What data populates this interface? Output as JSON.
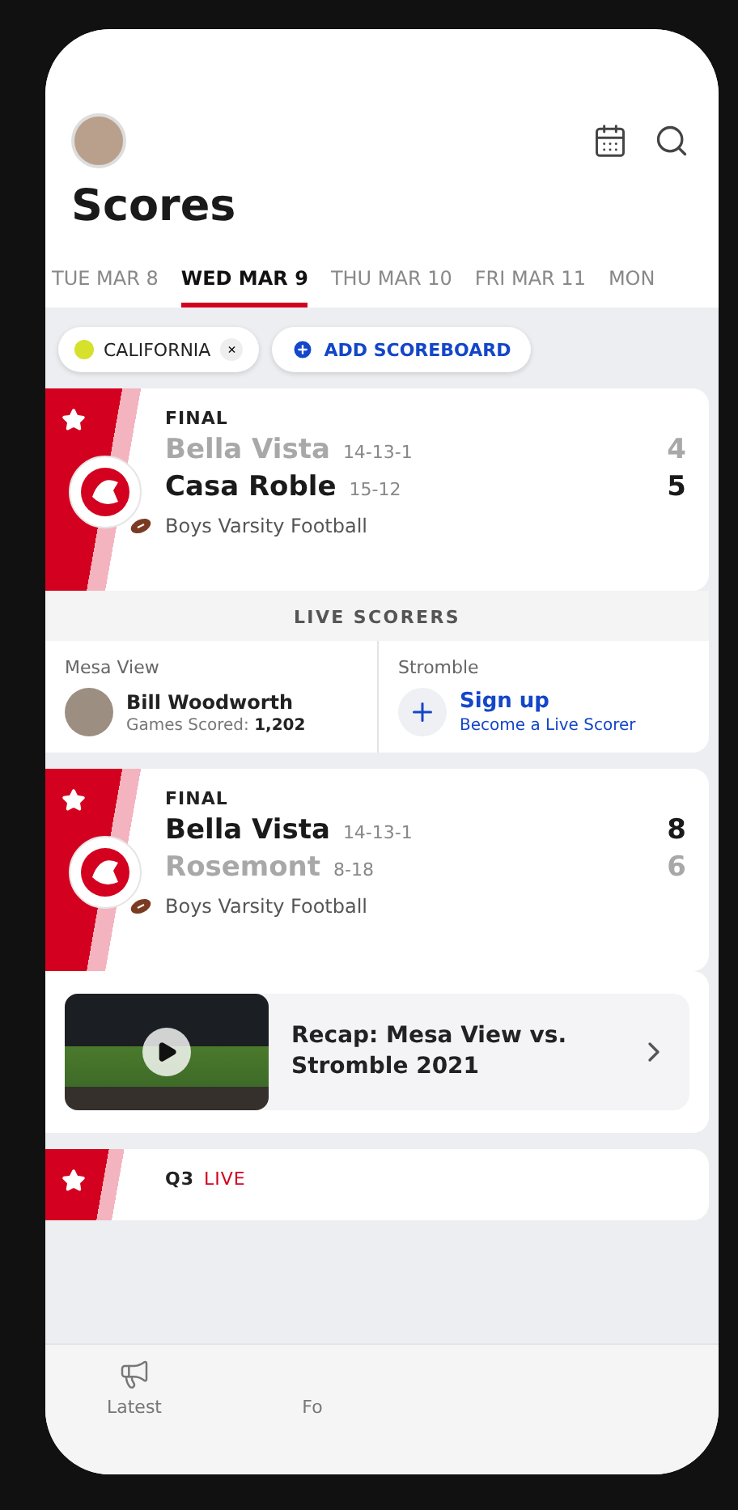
{
  "header": {
    "title": "Scores"
  },
  "date_tabs": [
    {
      "label": "TUE MAR 8",
      "selected": false
    },
    {
      "label": "WED MAR 9",
      "selected": true
    },
    {
      "label": "THU MAR 10",
      "selected": false
    },
    {
      "label": "FRI MAR 11",
      "selected": false
    },
    {
      "label": "MON",
      "selected": false
    }
  ],
  "filters": {
    "chips": [
      {
        "label": "CALIFORNIA",
        "remove": "×"
      }
    ],
    "add_button": "ADD SCOREBOARD"
  },
  "games": [
    {
      "status": "FINAL",
      "favorite": true,
      "sport": "Boys Varsity Football",
      "teams": [
        {
          "name": "Bella Vista",
          "record": "14-13-1",
          "score": "4",
          "winner": false
        },
        {
          "name": "Casa Roble",
          "record": "15-12",
          "score": "5",
          "winner": true
        }
      ],
      "live_scorers": {
        "title": "LIVE SCORERS",
        "entries": [
          {
            "kind": "scorer",
            "team": "Mesa View",
            "name": "Bill Woodworth",
            "stat_label": "Games Scored:",
            "stat_value": "1,202"
          },
          {
            "kind": "signup",
            "team": "Stromble",
            "action": "Sign up",
            "subtitle": "Become a Live Scorer"
          }
        ]
      }
    },
    {
      "status": "FINAL",
      "favorite": true,
      "sport": "Boys Varsity Football",
      "teams": [
        {
          "name": "Bella Vista",
          "record": "14-13-1",
          "score": "8",
          "winner": true
        },
        {
          "name": "Rosemont",
          "record": "8-18",
          "score": "6",
          "winner": false
        }
      ],
      "recap": {
        "title": "Recap: Mesa View vs. Stromble 2021"
      }
    },
    {
      "status": "Q3",
      "live_label": "LIVE",
      "favorite": true
    }
  ],
  "bottom_nav": [
    {
      "label": "Latest"
    },
    {
      "label": "Fo"
    }
  ]
}
